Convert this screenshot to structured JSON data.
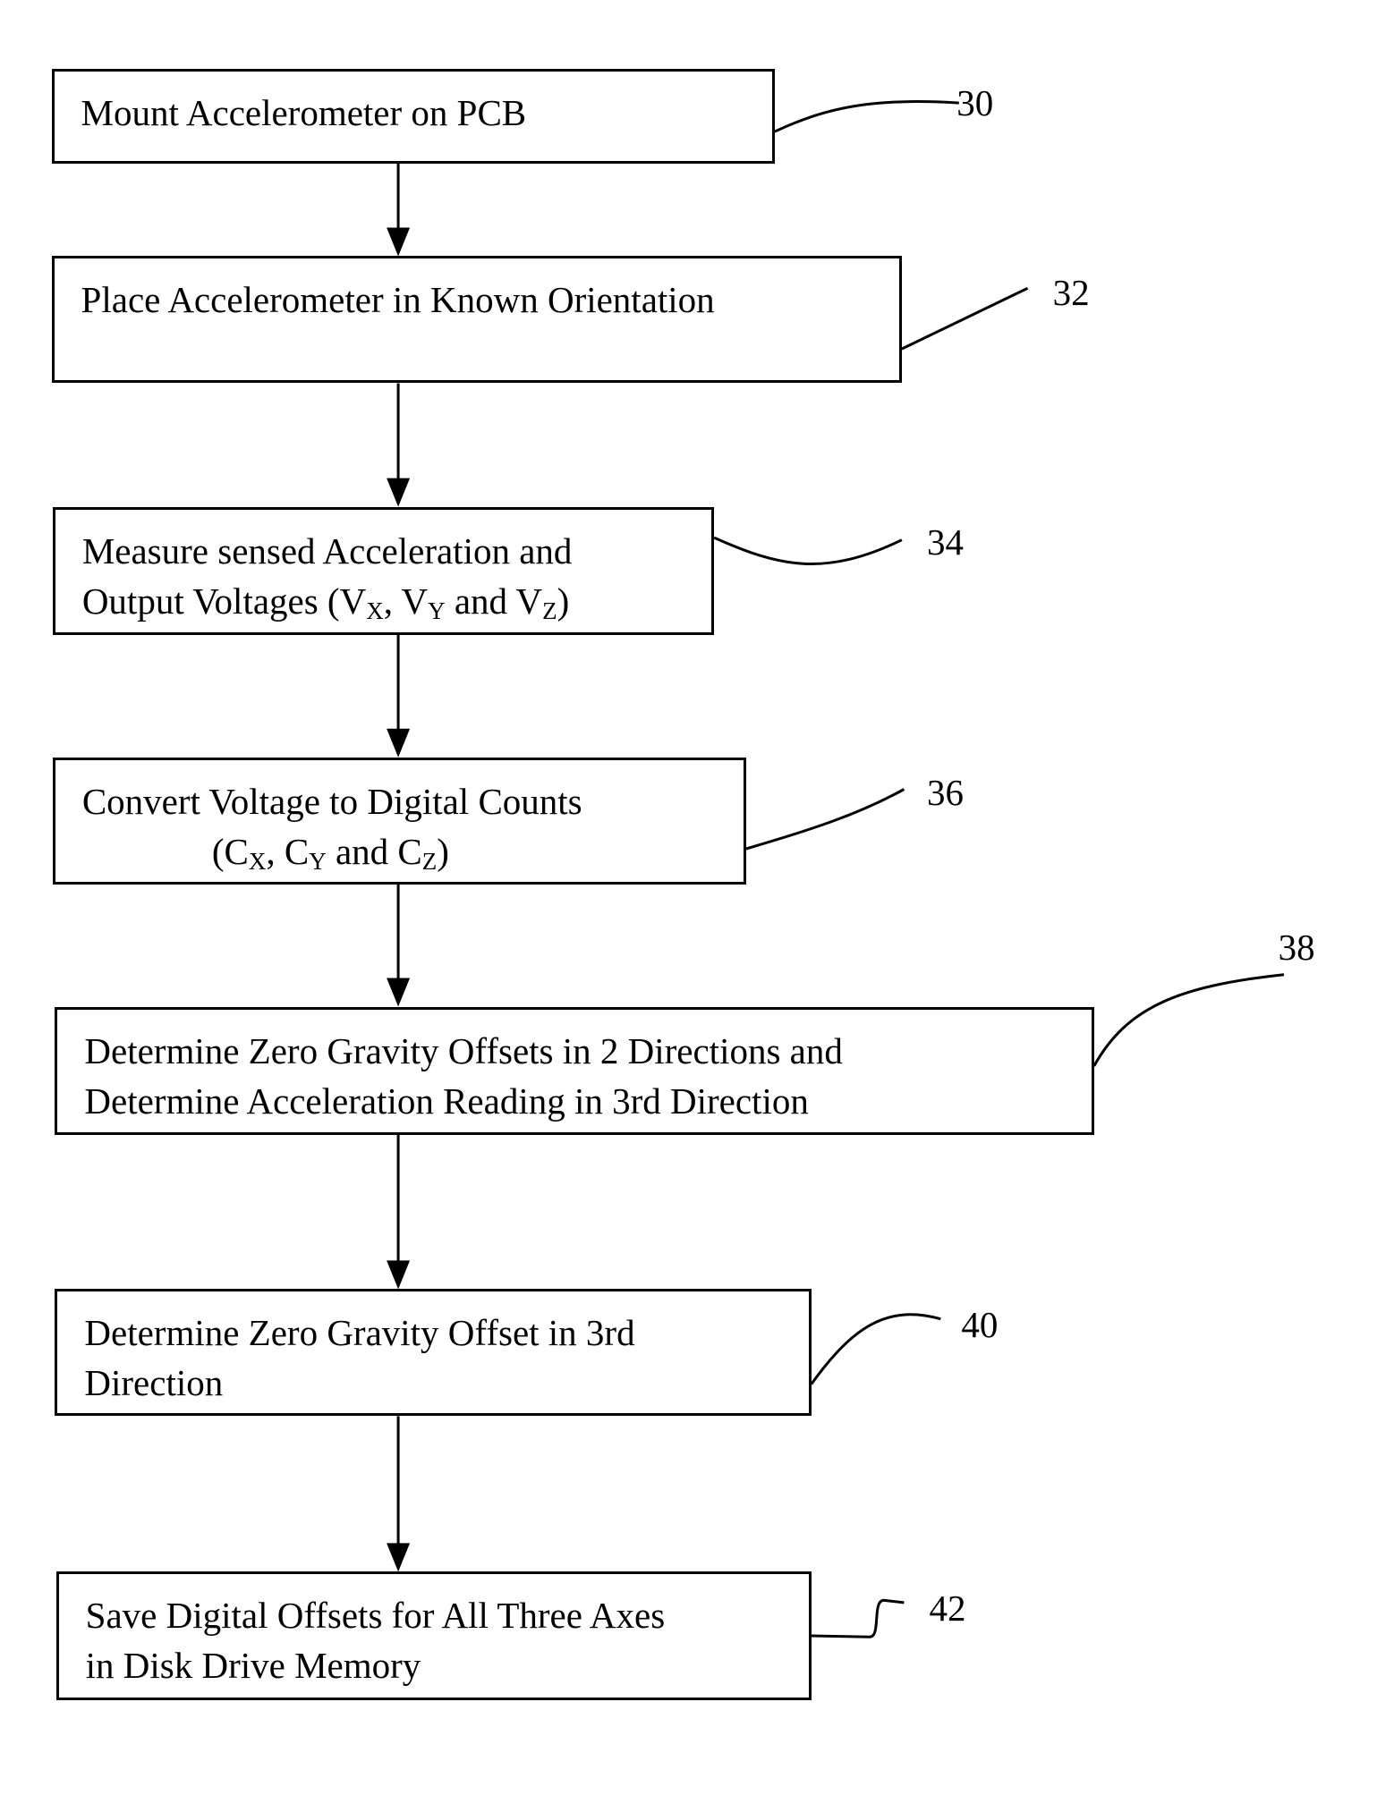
{
  "diagram": {
    "type": "flowchart",
    "direction": "top-to-bottom",
    "steps": [
      {
        "ref": "30",
        "lines": [
          {
            "parts": [
              {
                "t": "Mount Accelerometer on PCB"
              }
            ]
          }
        ]
      },
      {
        "ref": "32",
        "lines": [
          {
            "parts": [
              {
                "t": "Place Accelerometer in Known Orientation"
              }
            ]
          }
        ]
      },
      {
        "ref": "34",
        "lines": [
          {
            "parts": [
              {
                "t": "Measure sensed Acceleration and"
              }
            ]
          },
          {
            "parts": [
              {
                "t": "Output Voltages (V"
              },
              {
                "sub": "X"
              },
              {
                "t": ", V"
              },
              {
                "sub": "Y"
              },
              {
                "t": " and V"
              },
              {
                "sub": "Z"
              },
              {
                "t": ")"
              }
            ]
          }
        ]
      },
      {
        "ref": "36",
        "lines": [
          {
            "parts": [
              {
                "t": "Convert Voltage to Digital Counts"
              }
            ]
          },
          {
            "indent": true,
            "parts": [
              {
                "t": "(C"
              },
              {
                "sub": "X"
              },
              {
                "t": ", C"
              },
              {
                "sub": "Y"
              },
              {
                "t": " and C"
              },
              {
                "sub": "Z"
              },
              {
                "t": ")"
              }
            ]
          }
        ]
      },
      {
        "ref": "38",
        "lines": [
          {
            "parts": [
              {
                "t": "Determine Zero Gravity Offsets in 2 Directions and"
              }
            ]
          },
          {
            "parts": [
              {
                "t": "Determine Acceleration Reading in 3rd Direction"
              }
            ]
          }
        ]
      },
      {
        "ref": "40",
        "lines": [
          {
            "parts": [
              {
                "t": "Determine Zero Gravity Offset in 3rd"
              }
            ]
          },
          {
            "parts": [
              {
                "t": "Direction"
              }
            ]
          }
        ]
      },
      {
        "ref": "42",
        "lines": [
          {
            "parts": [
              {
                "t": "Save Digital Offsets for All Three Axes"
              }
            ]
          },
          {
            "parts": [
              {
                "t": "in Disk Drive Memory"
              }
            ]
          }
        ]
      }
    ],
    "edges": [
      {
        "from": "30",
        "to": "32"
      },
      {
        "from": "32",
        "to": "34"
      },
      {
        "from": "34",
        "to": "36"
      },
      {
        "from": "36",
        "to": "38"
      },
      {
        "from": "38",
        "to": "40"
      },
      {
        "from": "40",
        "to": "42"
      }
    ],
    "colors": {
      "stroke": "#000000",
      "background": "#ffffff",
      "text": "#000000"
    }
  }
}
